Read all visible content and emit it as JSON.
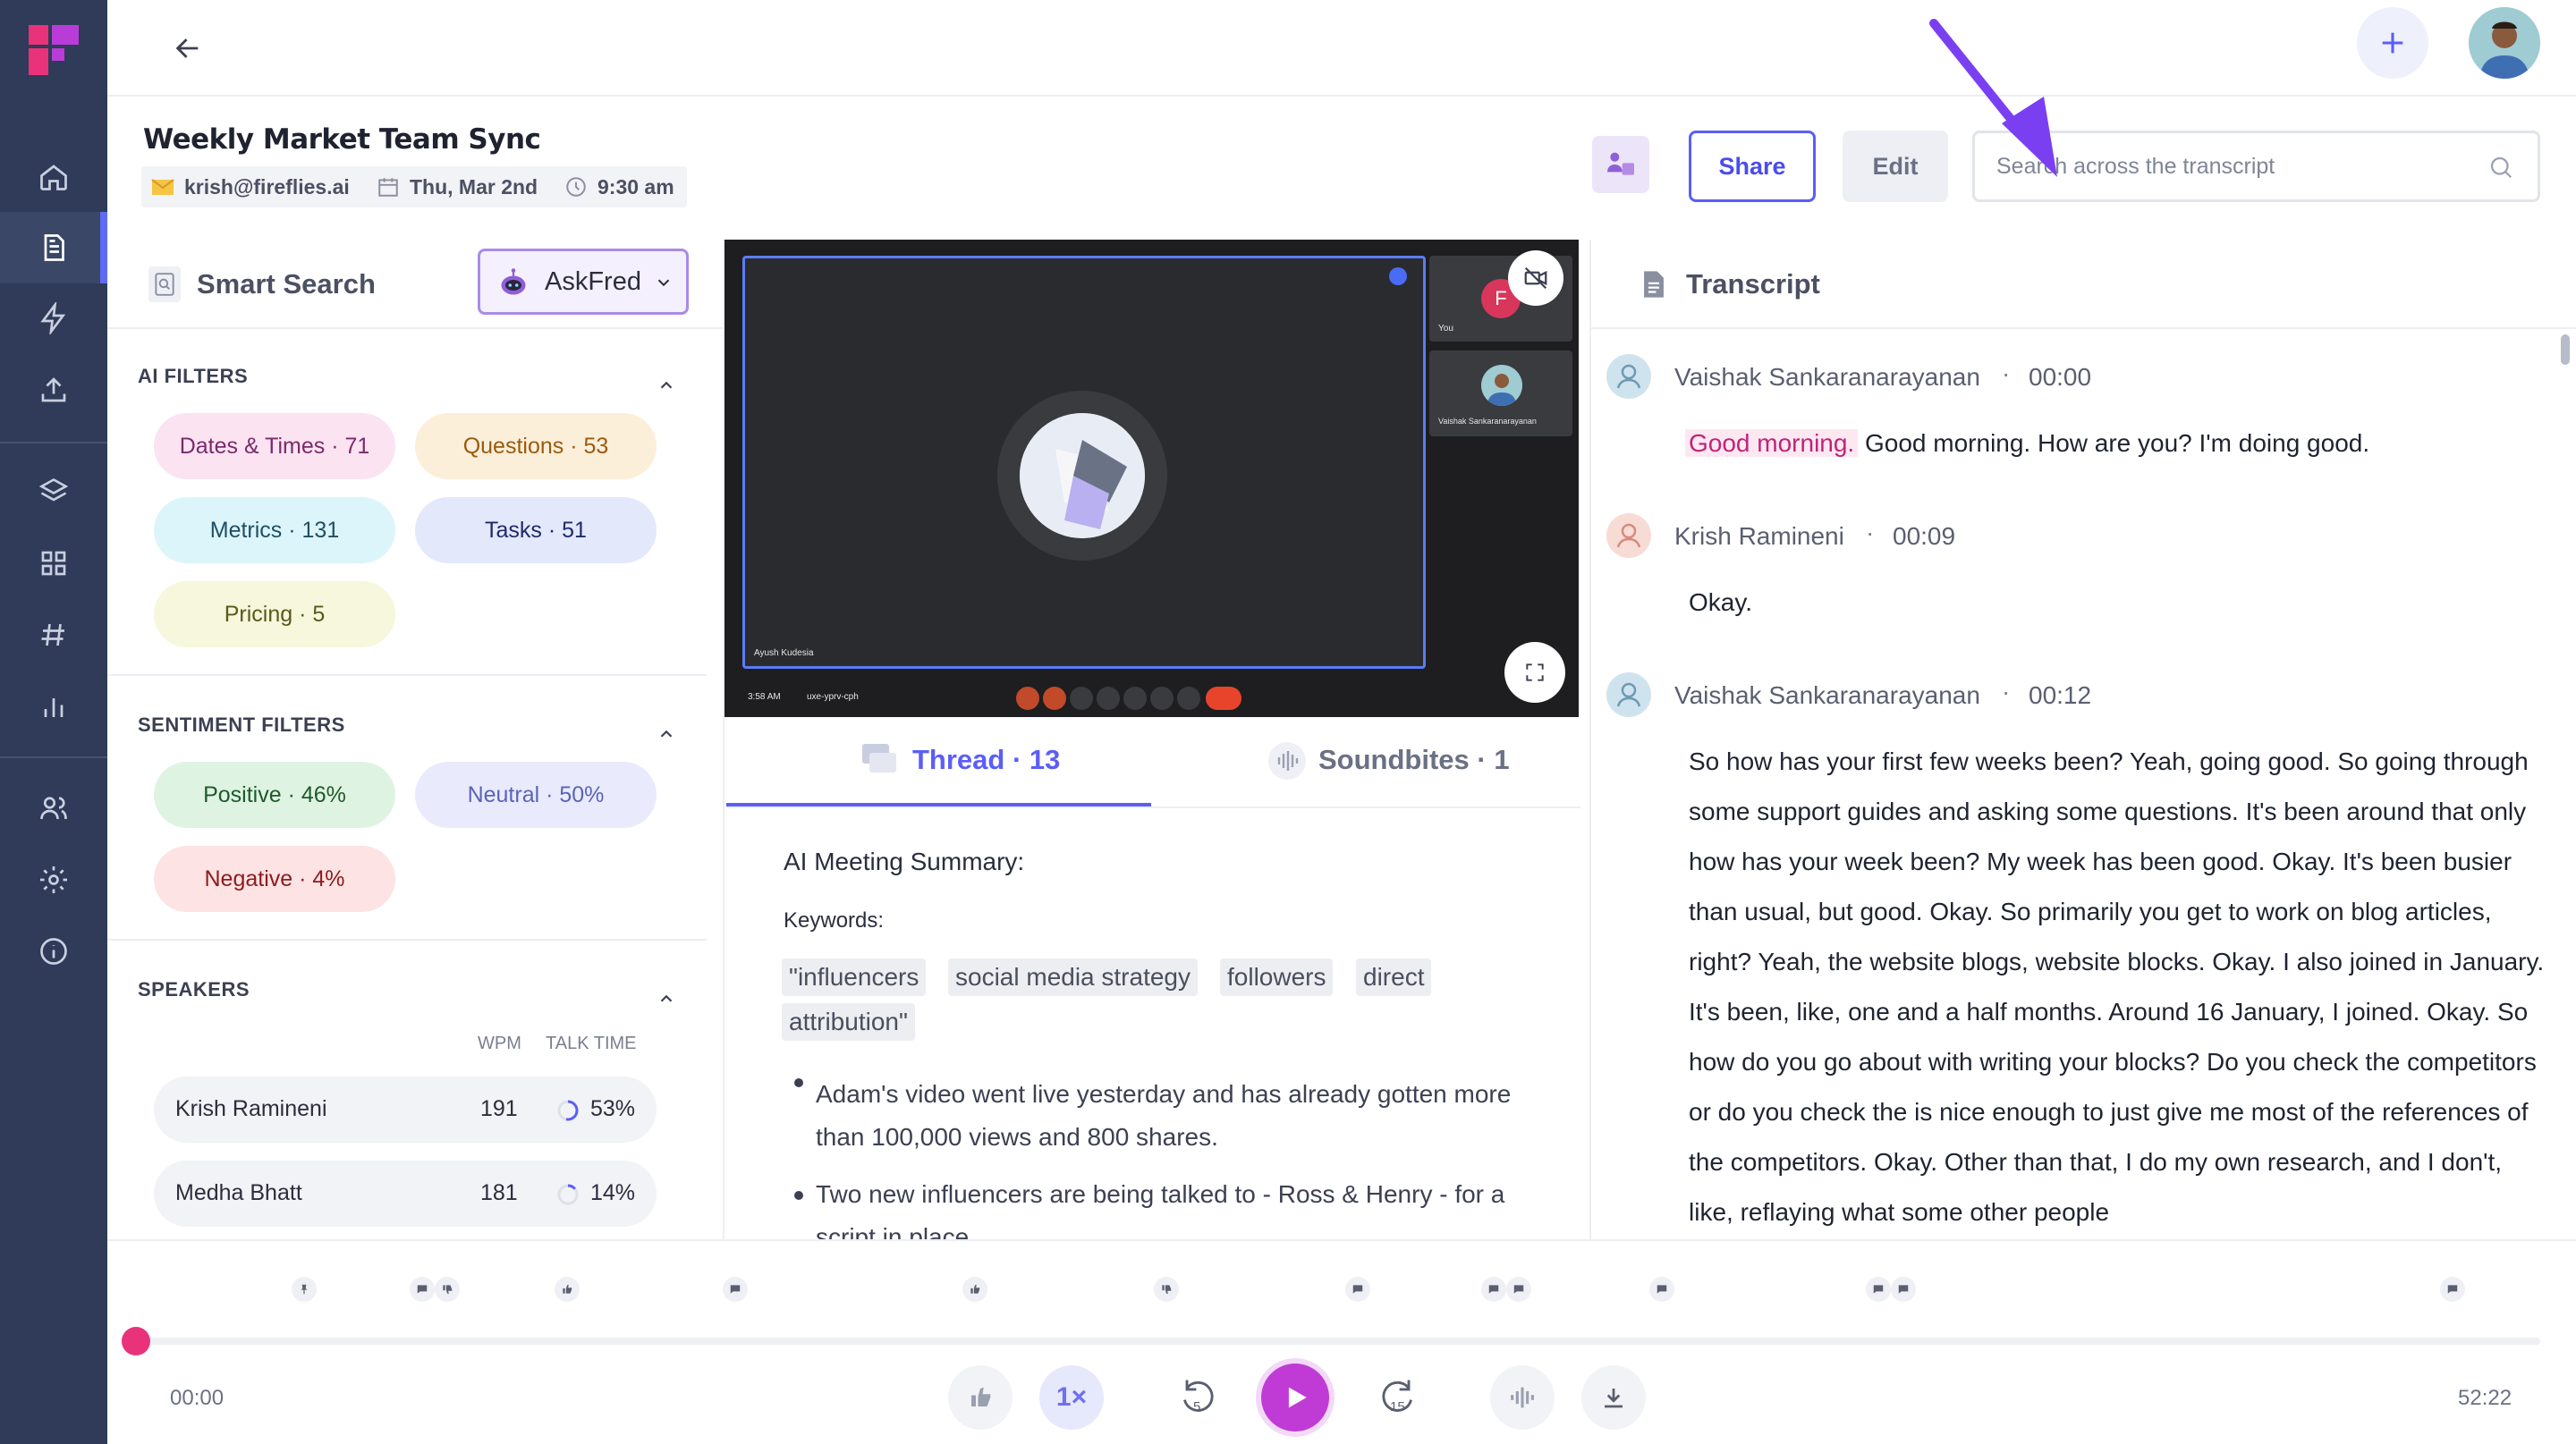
{
  "meeting": {
    "title": "Weekly Market Team Sync",
    "organizer": "krish@fireflies.ai",
    "date": "Thu, Mar 2nd",
    "time": "9:30 am"
  },
  "header": {
    "share_label": "Share",
    "edit_label": "Edit",
    "search_placeholder": "Search across the transcript"
  },
  "smart_search": {
    "title": "Smart Search",
    "askfred_label": "AskFred",
    "ai_filters_heading": "AI FILTERS",
    "ai_filters": [
      {
        "label": "Dates & Times · 71",
        "color": "#fbe3f2",
        "text_color": "#7a2a6a"
      },
      {
        "label": "Questions · 53",
        "color": "#fcefd9",
        "text_color": "#9a5a10"
      },
      {
        "label": "Metrics · 131",
        "color": "#dcf5fa",
        "text_color": "#1f4f63"
      },
      {
        "label": "Tasks · 51",
        "color": "#e3e8fb",
        "text_color": "#1f2a6a"
      },
      {
        "label": "Pricing · 5",
        "color": "#f6f7dc",
        "text_color": "#5a5a1a"
      }
    ],
    "sentiment_heading": "SENTIMENT FILTERS",
    "sentiment_filters": [
      {
        "label": "Positive · 46%",
        "color": "#dff3e2",
        "text_color": "#1e5a2a"
      },
      {
        "label": "Neutral · 50%",
        "color": "#e9ebfc",
        "text_color": "#5b63b8"
      },
      {
        "label": "Negative · 4%",
        "color": "#fde3e4",
        "text_color": "#8e1a1e"
      }
    ],
    "speakers_heading": "SPEAKERS",
    "wpm_label": "WPM",
    "talk_time_label": "TALK TIME",
    "speakers": [
      {
        "name": "Krish Ramineni",
        "wpm": "191",
        "talk": "53%",
        "talk_fraction": 0.53
      },
      {
        "name": "Medha Bhatt",
        "wpm": "181",
        "talk": "14%",
        "talk_fraction": 0.14
      }
    ]
  },
  "video": {
    "main_tile_name": "Ayush Kudesia",
    "self_label": "You",
    "self_initial": "F",
    "participant_name": "Vaishak Sankaranarayanan",
    "clock": "3:58 AM",
    "meeting_code": "uxe-yprv-cph"
  },
  "tabs": [
    {
      "label": "Thread · 13",
      "active": true
    },
    {
      "label": "Soundbites · 1",
      "active": false
    }
  ],
  "summary": {
    "heading": "AI Meeting Summary:",
    "keywords_label": "Keywords:",
    "keywords": [
      "\"influencers",
      "social media strategy",
      "followers",
      "direct",
      "attribution\""
    ],
    "bullets": [
      "Adam's video went live yesterday and has already gotten more than 100,000 views and 800 shares.",
      "Two new influencers are being talked to - Ross & Henry - for a script in place."
    ]
  },
  "transcript": {
    "title": "Transcript",
    "entries": [
      {
        "speaker": "Vaishak Sankaranarayanan",
        "time": "00:00",
        "highlight": "Good morning.",
        "text": "Good morning. How are you? I'm doing good.",
        "avatar_color": "#cfe3ee"
      },
      {
        "speaker": "Krish Ramineni",
        "time": "00:09",
        "highlight": "",
        "text": "Okay.",
        "avatar_color": "#f7dcd6"
      },
      {
        "speaker": "Vaishak Sankaranarayanan",
        "time": "00:12",
        "highlight": "",
        "text": "So how has your first few weeks been? Yeah, going good. So going through some support guides and asking some questions. It's been around that only how has your week been? My week has been good. Okay. It's been busier than usual, but good. Okay. So primarily you get to work on blog articles, right? Yeah, the website blogs, website blocks. Okay. I also joined in January. It's been, like, one and a half months. Around 16 January, I joined. Okay. So how do you go about with writing your blocks? Do you check the competitors or do you check the is nice enough to just give me most of the references of the competitors. Okay. Other than that, I do my own research, and I don't, like, reflaying what some other people",
        "avatar_color": "#cfe3ee"
      }
    ]
  },
  "player": {
    "current_time": "00:00",
    "total_time": "52:22",
    "speed_label": "1×",
    "rewind_label": "5",
    "forward_label": "15",
    "progress": 0.0,
    "accent": "#e8337a",
    "play_color": "#c03bd6"
  },
  "colors": {
    "sidebar": "#2f3b58",
    "primary": "#5b5ef7",
    "annotation_arrow": "#7b3ff2"
  }
}
